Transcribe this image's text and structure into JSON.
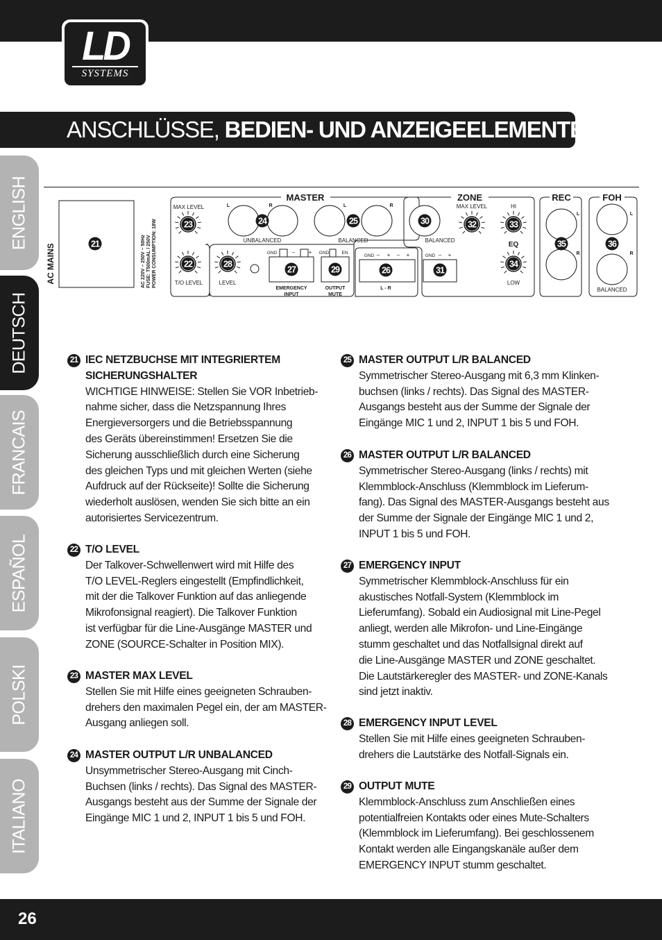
{
  "brand": {
    "logo_text": "LD",
    "logo_sub": "SYSTEMS"
  },
  "title": {
    "light": "ANSCHLÜSSE, ",
    "bold": "BEDIEN- UND ANZEIGEELEMENTE:"
  },
  "language_tabs": [
    {
      "label": "ENGLISH",
      "active": false
    },
    {
      "label": "DEUTSCH",
      "active": true
    },
    {
      "label": "FRANCAIS",
      "active": false
    },
    {
      "label": "ESPAÑOL",
      "active": false
    },
    {
      "label": "POLSKI",
      "active": false
    },
    {
      "label": "ITALIANO",
      "active": false
    }
  ],
  "diagram": {
    "ac_mains": "AC MAINS",
    "spec_lines": [
      "AC 220V – 250V ~ 50Hz",
      "FUSE: T500mAL / 250V",
      "POWER CONSUMPTION: 18W"
    ],
    "master": "MASTER",
    "zone": "ZONE",
    "rec": "REC",
    "foh": "FOH",
    "max_level": "MAX LEVEL",
    "to_level": "T/O LEVEL",
    "level": "LEVEL",
    "unbalanced": "UNBALANCED",
    "balanced": "BALANCED",
    "l": "L",
    "r": "R",
    "gnd": "GND",
    "minus": "–",
    "plus": "+",
    "en": "EN",
    "emergency": "EMERGENCY",
    "input": "INPUT",
    "output": "OUTPUT",
    "mute": "MUTE",
    "lr": "L - R",
    "hi": "HI",
    "eq": "EQ",
    "low": "LOW",
    "badges": [
      "21",
      "22",
      "23",
      "24",
      "25",
      "26",
      "27",
      "28",
      "29",
      "30",
      "31",
      "32",
      "33",
      "34",
      "35",
      "36"
    ]
  },
  "sections": [
    {
      "num": "21",
      "heading": [
        "IEC NETZBUCHSE MIT INTEGRIERTEM",
        "SICHERUNGSHALTER"
      ],
      "lines": [
        "WICHTIGE HINWEISE: Stellen Sie VOR Inbetrieb-",
        "nahme sicher, dass die Netzspannung Ihres",
        "Energieversorgers und die Betriebsspannung",
        "des Geräts übereinstimmen! Ersetzen Sie die",
        "Sicherung ausschließlich durch eine Sicherung",
        "des gleichen Typs und mit gleichen Werten (siehe",
        "Aufdruck auf der Rückseite)! Sollte die Sicherung",
        "wiederholt auslösen, wenden Sie sich bitte an ein",
        "autorisiertes Servicezentrum."
      ]
    },
    {
      "num": "22",
      "heading": [
        "T/O LEVEL"
      ],
      "lines": [
        "Der Talkover-Schwellenwert wird mit Hilfe des",
        "T/O LEVEL-Reglers eingestellt (Empfindlichkeit,",
        "mit der die Talkover Funktion auf das anliegende",
        "Mikrofonsignal reagiert). Die Talkover Funktion",
        "ist verfügbar für die Line-Ausgänge MASTER und",
        "ZONE (SOURCE-Schalter in Position MIX)."
      ]
    },
    {
      "num": "23",
      "heading": [
        "MASTER MAX LEVEL"
      ],
      "lines": [
        "Stellen Sie mit Hilfe eines geeigneten Schrauben-",
        "drehers den maximalen Pegel ein, der am MASTER-",
        "Ausgang anliegen soll."
      ]
    },
    {
      "num": "24",
      "heading": [
        "MASTER OUTPUT L/R UNBALANCED"
      ],
      "lines": [
        "Unsymmetrischer Stereo-Ausgang mit Cinch-",
        "Buchsen (links / rechts). Das Signal des MASTER-",
        "Ausgangs besteht aus der Summe der Signale der",
        "Eingänge MIC 1 und 2, INPUT 1 bis 5 und FOH."
      ]
    },
    {
      "num": "25",
      "heading": [
        "MASTER OUTPUT L/R BALANCED"
      ],
      "lines": [
        "Symmetrischer Stereo-Ausgang mit 6,3 mm Klinken-",
        "buchsen (links / rechts). Das Signal des MASTER-",
        "Ausgangs besteht aus der Summe der Signale der",
        "Eingänge MIC 1 und 2, INPUT 1 bis 5 und FOH."
      ]
    },
    {
      "num": "26",
      "heading": [
        "MASTER OUTPUT L/R BALANCED"
      ],
      "lines": [
        "Symmetrischer Stereo-Ausgang (links / rechts) mit",
        "Klemmblock-Anschluss (Klemmblock im Lieferum-",
        "fang). Das Signal des MASTER-Ausgangs besteht aus",
        "der Summe der Signale der Eingänge MIC 1 und 2,",
        "INPUT 1 bis 5 und FOH."
      ]
    },
    {
      "num": "27",
      "heading": [
        "EMERGENCY INPUT"
      ],
      "lines": [
        "Symmetrischer Klemmblock-Anschluss für ein",
        "akustisches Notfall-System (Klemmblock im",
        "Lieferumfang). Sobald ein Audiosignal mit Line-Pegel",
        "anliegt, werden alle Mikrofon- und Line-Eingänge",
        "stumm geschaltet und das Notfallsignal direkt auf",
        "die Line-Ausgänge MASTER und ZONE geschaltet.",
        "Die Lautstärkeregler des MASTER- und ZONE-Kanals",
        "sind jetzt inaktiv."
      ]
    },
    {
      "num": "28",
      "heading": [
        "EMERGENCY INPUT LEVEL"
      ],
      "lines": [
        "Stellen Sie mit Hilfe eines geeigneten Schrauben-",
        "drehers die Lautstärke des Notfall-Signals ein."
      ]
    },
    {
      "num": "29",
      "heading": [
        "OUTPUT MUTE"
      ],
      "lines": [
        "Klemmblock-Anschluss zum Anschließen eines",
        "potentialfreien Kontakts oder eines Mute-Schalters",
        "(Klemmblock im Lieferumfang). Bei geschlossenem",
        "Kontakt werden alle Eingangskanäle außer dem",
        "EMERGENCY INPUT stumm geschaltet."
      ]
    }
  ],
  "page_number": "26"
}
